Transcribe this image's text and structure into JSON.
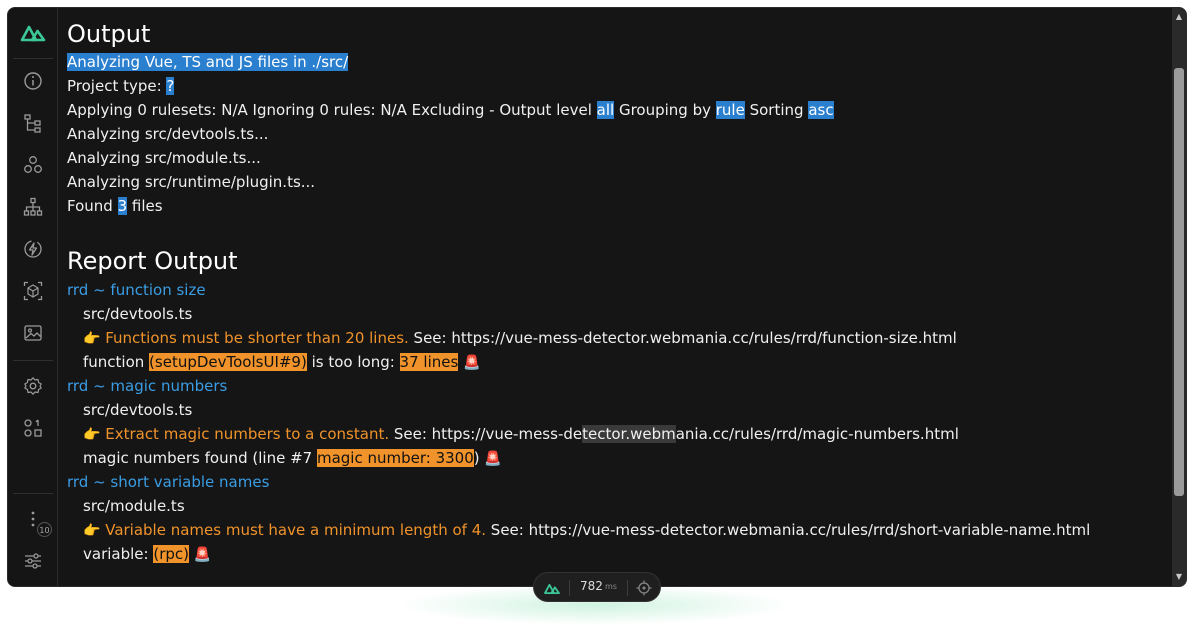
{
  "output": {
    "heading": "Output",
    "analyzing": "Analyzing Vue, TS and JS files in ./src/",
    "project_type_label": "Project type: ",
    "project_type_value": "?",
    "applying_prefix": "Applying 0 rulesets: N/A Ignoring 0 rules: N/A Excluding - Output level ",
    "output_level": "all",
    "grouping_label": " Grouping by ",
    "grouping": "rule",
    "sorting_label": " Sorting ",
    "sorting": "asc",
    "files_analyzed": [
      "Analyzing src/devtools.ts...",
      "Analyzing src/module.ts...",
      "Analyzing src/runtime/plugin.ts..."
    ],
    "found_prefix": "Found ",
    "found_count": "3",
    "found_suffix": " files"
  },
  "report": {
    "heading": "Report Output",
    "groups": [
      {
        "rule": "rrd ~ function size",
        "file": "src/devtools.ts",
        "hint_emoji": "👉",
        "hint": "Functions must be shorter than 20 lines.",
        "see": " See: https://vue-mess-detector.webmania.cc/rules/rrd/function-size.html",
        "detail_prefix": "function ",
        "detail_hl1": "(setupDevToolsUI#9)",
        "detail_mid": " is too long: ",
        "detail_hl2": "37 lines",
        "alarm": "🚨"
      },
      {
        "rule": "rrd ~ magic numbers",
        "file": "src/devtools.ts",
        "hint_emoji": "👉",
        "hint": "Extract magic numbers to a constant.",
        "see_a": " See: https://vue-mess-de",
        "see_sel": "tector.webm",
        "see_b": "ania.cc/rules/rrd/magic-numbers.html",
        "detail_prefix": "magic numbers found (line #7 ",
        "detail_hl": "magic number: 3300",
        "detail_suffix": ")",
        "alarm": "🚨"
      },
      {
        "rule": "rrd ~ short variable names",
        "file": "src/module.ts",
        "hint_emoji": "👉",
        "hint": "Variable names must have a minimum length of 4.",
        "see": " See: https://vue-mess-detector.webmania.cc/rules/rrd/short-variable-name.html",
        "detail_prefix": "variable: ",
        "detail_hl": "(rpc)",
        "alarm": "🚨"
      }
    ]
  },
  "sidebar": {
    "icons": [
      "info-icon",
      "tree-icon",
      "components-icon",
      "hierarchy-icon",
      "lightning-icon",
      "cube-icon",
      "image-icon",
      "settings-icon",
      "modules-icon",
      "more-icon",
      "sliders-icon"
    ],
    "badge_count": "10"
  },
  "status": {
    "ms_value": "782",
    "ms_unit": "ms"
  },
  "colors": {
    "background": "#151515",
    "accent_green": "#3cc796",
    "highlight_blue": "#2b7fcf",
    "highlight_orange": "#f0932b",
    "rule_blue": "#3a9de3"
  }
}
